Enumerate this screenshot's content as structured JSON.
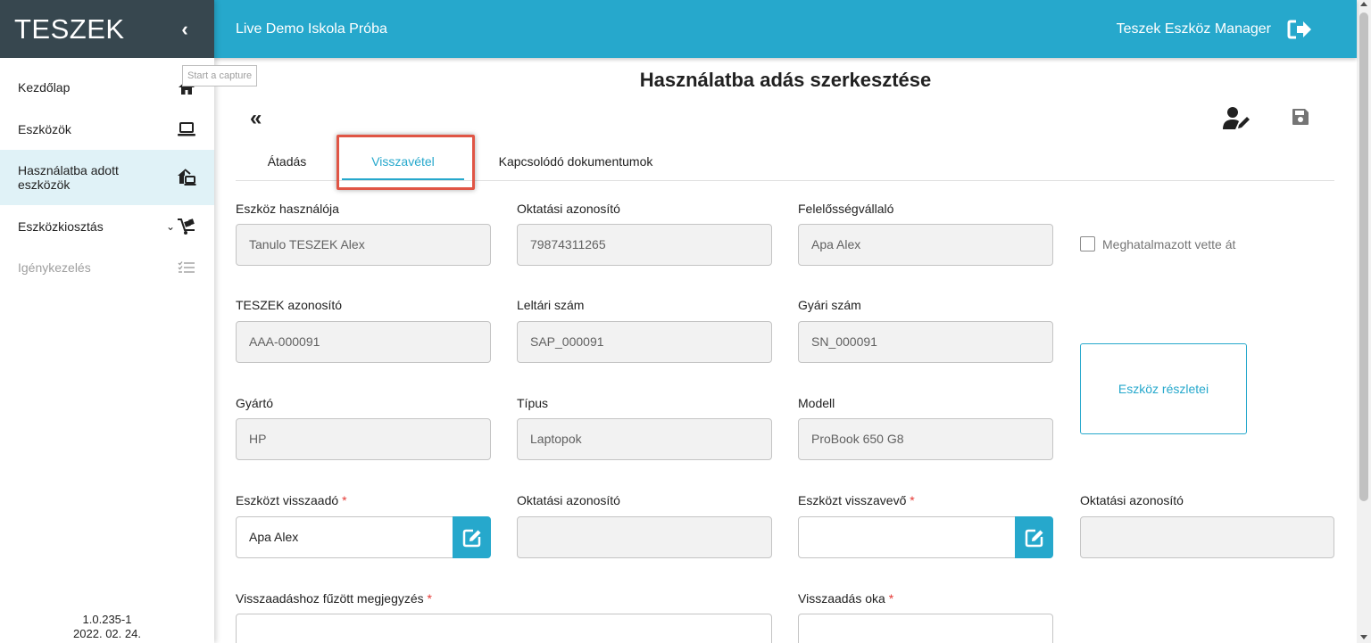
{
  "sidebar": {
    "brand": "TESZEK",
    "collapse_icon": "chevron-left-icon",
    "items": [
      {
        "label": "Kezdőlap",
        "icon": "home-icon"
      },
      {
        "label": "Eszközök",
        "icon": "laptop-icon"
      },
      {
        "label": "Használatba adott eszközök",
        "icon": "house-device-icon"
      },
      {
        "label": "Eszközkiosztás",
        "icon": "hand-truck-icon"
      },
      {
        "label": "Igénykezelés",
        "icon": "checklist-icon"
      }
    ],
    "tooltip": "Start a capture",
    "version": "1.0.235-1",
    "date": "2022. 02. 24."
  },
  "topbar": {
    "title": "Live Demo Iskola Próba",
    "user": "Teszek Eszköz Manager",
    "logout_icon": "logout-icon"
  },
  "page": {
    "title": "Használatba adás szerkesztése",
    "back_icon": "double-chevron-left-icon",
    "assign_icon": "person-edit-icon",
    "save_icon": "save-icon"
  },
  "tabs": [
    "Átadás",
    "Visszavétel",
    "Kapcsolódó dokumentumok"
  ],
  "active_tab": "Visszavétel",
  "form": {
    "user_label": "Eszköz használója",
    "user_value": "Tanulo TESZEK Alex",
    "edu_id_label": "Oktatási azonosító",
    "edu_id_value": "79874311265",
    "responsible_label": "Felelősségvállaló",
    "responsible_value": "Apa Alex",
    "authorized_label": "Meghatalmazott vette át",
    "teszek_id_label": "TESZEK azonosító",
    "teszek_id_value": "AAA-000091",
    "inventory_label": "Leltári szám",
    "inventory_value": "SAP_000091",
    "serial_label": "Gyári szám",
    "serial_value": "SN_000091",
    "manufacturer_label": "Gyártó",
    "manufacturer_value": "HP",
    "type_label": "Típus",
    "type_value": "Laptopok",
    "model_label": "Modell",
    "model_value": "ProBook 650 G8",
    "details_button": "Eszköz részletei",
    "returner_label": "Eszközt visszaadó",
    "returner_value": "Apa Alex",
    "returner_edu_label": "Oktatási azonosító",
    "returner_edu_value": "",
    "receiver_label": "Eszközt visszavevő",
    "receiver_value": "",
    "receiver_edu_label": "Oktatási azonosító",
    "receiver_edu_value": "",
    "note_label": "Visszaadáshoz fűzött megjegyzés",
    "reason_label": "Visszaadás oka",
    "required_mark": "*"
  },
  "colors": {
    "accent": "#26a8cc",
    "brand_bg": "#37474f",
    "active_nav_bg": "#e0f2f7",
    "highlight": "#e05545",
    "required": "#e53935"
  }
}
